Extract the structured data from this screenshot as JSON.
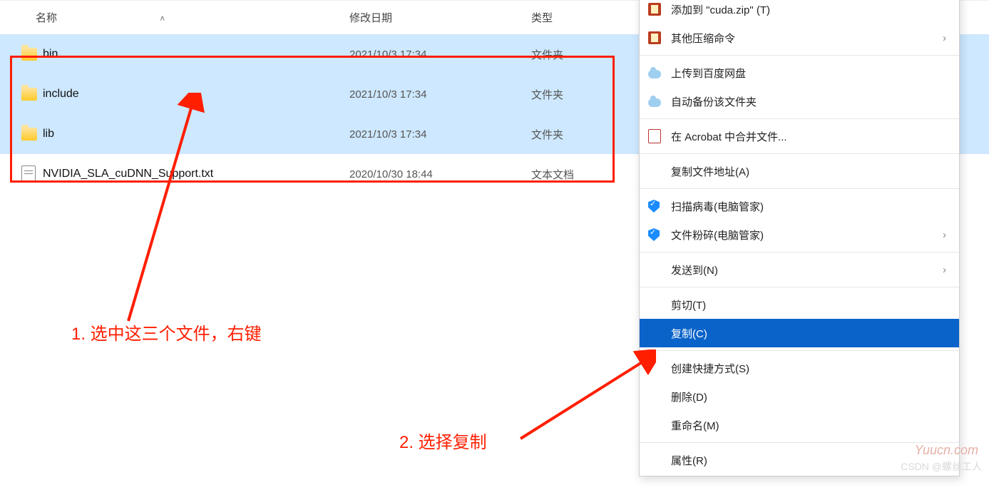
{
  "columns": {
    "name": "名称",
    "date": "修改日期",
    "type": "类型"
  },
  "files": [
    {
      "name": "bin",
      "date": "2021/10/3 17:34",
      "type": "文件夹",
      "kind": "folder",
      "selected": true
    },
    {
      "name": "include",
      "date": "2021/10/3 17:34",
      "type": "文件夹",
      "kind": "folder",
      "selected": true
    },
    {
      "name": "lib",
      "date": "2021/10/3 17:34",
      "type": "文件夹",
      "kind": "folder",
      "selected": true
    },
    {
      "name": "NVIDIA_SLA_cuDNN_Support.txt",
      "date": "2020/10/30 18:44",
      "type": "文本文档",
      "kind": "txt",
      "selected": false
    }
  ],
  "menu": [
    {
      "icon": "zip",
      "label": "添加到 \"cuda.zip\" (T)"
    },
    {
      "icon": "zip",
      "label": "其他压缩命令",
      "submenu": true
    },
    {
      "sep": true
    },
    {
      "icon": "cloud",
      "label": "上传到百度网盘"
    },
    {
      "icon": "cloud",
      "label": "自动备份该文件夹"
    },
    {
      "sep": true
    },
    {
      "icon": "pdf",
      "label": "在 Acrobat 中合并文件..."
    },
    {
      "sep": true
    },
    {
      "icon": "",
      "label": "复制文件地址(A)"
    },
    {
      "sep": true
    },
    {
      "icon": "shield",
      "label": "扫描病毒(电脑管家)"
    },
    {
      "icon": "shield",
      "label": "文件粉碎(电脑管家)",
      "submenu": true
    },
    {
      "sep": true
    },
    {
      "icon": "",
      "label": "发送到(N)",
      "submenu": true
    },
    {
      "sep": true
    },
    {
      "icon": "",
      "label": "剪切(T)"
    },
    {
      "icon": "",
      "label": "复制(C)",
      "highlight": true
    },
    {
      "sep": true
    },
    {
      "icon": "",
      "label": "创建快捷方式(S)"
    },
    {
      "icon": "",
      "label": "删除(D)"
    },
    {
      "icon": "",
      "label": "重命名(M)"
    },
    {
      "sep": true
    },
    {
      "icon": "",
      "label": "属性(R)"
    }
  ],
  "annotations": {
    "step1": "1. 选中这三个文件，右键",
    "step2": "2. 选择复制"
  },
  "watermark_site": "Yuucn.com",
  "watermark_csdn": "CSDN @螺丝工人"
}
